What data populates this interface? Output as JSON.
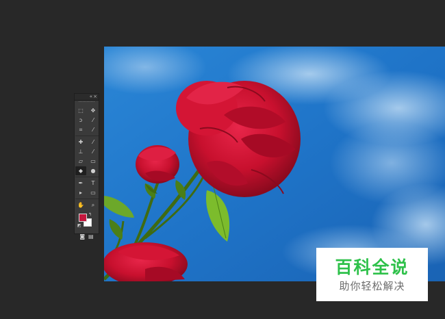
{
  "app": {
    "canvas_background": "#282828",
    "panel_background": "#3a3a3a"
  },
  "toolbox": {
    "collapse_glyph": "«",
    "close_glyph": "×",
    "tools": [
      {
        "name": "marquee-tool-icon",
        "glyph": "⬚"
      },
      {
        "name": "move-tool-icon",
        "glyph": "✥"
      },
      {
        "name": "lasso-tool-icon",
        "glyph": "ↄ"
      },
      {
        "name": "magic-wand-icon",
        "glyph": "⁄"
      },
      {
        "name": "crop-tool-icon",
        "glyph": "⌗"
      },
      {
        "name": "eyedropper-icon",
        "glyph": "⁄"
      },
      {
        "name": "healing-brush-icon",
        "glyph": "✚"
      },
      {
        "name": "brush-tool-icon",
        "glyph": "⁄"
      },
      {
        "name": "clone-stamp-icon",
        "glyph": "⊥"
      },
      {
        "name": "history-brush-icon",
        "glyph": "⁄"
      },
      {
        "name": "eraser-tool-icon",
        "glyph": "▱"
      },
      {
        "name": "gradient-tool-icon",
        "glyph": "▭"
      },
      {
        "name": "blur-tool-icon",
        "glyph": "◆"
      },
      {
        "name": "dodge-tool-icon",
        "glyph": "●"
      },
      {
        "name": "pen-tool-icon",
        "glyph": "✒"
      },
      {
        "name": "type-tool-icon",
        "glyph": "T"
      },
      {
        "name": "path-selection-icon",
        "glyph": "▸"
      },
      {
        "name": "rectangle-tool-icon",
        "glyph": "▭"
      },
      {
        "name": "hand-tool-icon",
        "glyph": "✋"
      },
      {
        "name": "zoom-tool-icon",
        "glyph": "⌕"
      }
    ],
    "foreground_color": "#c4173d",
    "background_color": "#ffffff",
    "swap_glyph": "↰",
    "default_glyph": "◩",
    "quick_mask_glyph": "◙",
    "screen_mode_glyph": "▤"
  },
  "document": {
    "sky_color": "#1f74c8",
    "rose_color": "#c8102e",
    "leaf_color": "#5a9a1c"
  },
  "watermark": {
    "title": "百科全说",
    "subtitle": "助你轻松解决",
    "title_color": "#2ec14a",
    "subtitle_color": "#6b6b6b"
  }
}
